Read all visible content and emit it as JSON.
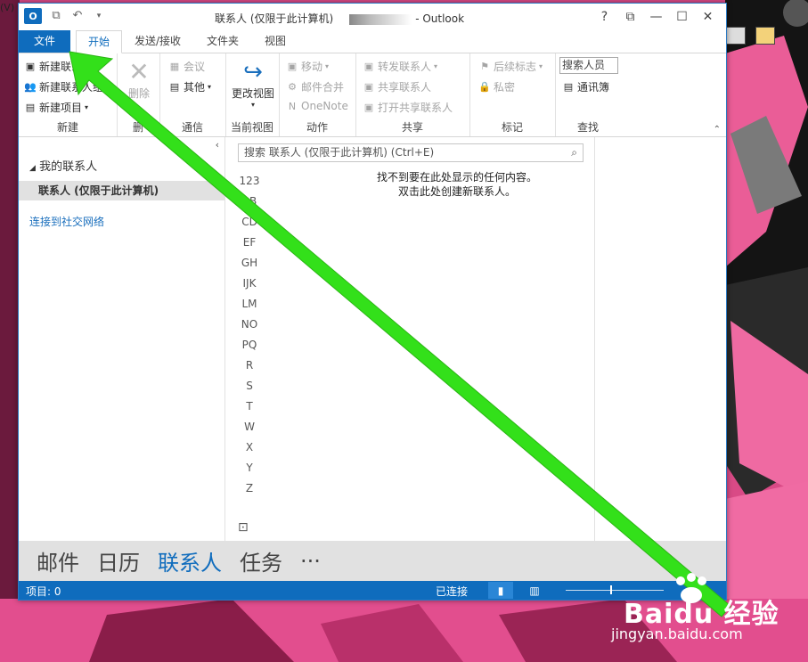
{
  "window": {
    "title": "联系人 (仅限于此计算机)",
    "app": "- Outlook",
    "logo": "O"
  },
  "bg": {
    "menu_fragment": "(V)"
  },
  "winbtns": {
    "help": "?",
    "ribbon_opts": "⧉",
    "min": "—",
    "max": "☐",
    "close": "✕"
  },
  "tabs": [
    "文件",
    "开始",
    "发送/接收",
    "文件夹",
    "视图"
  ],
  "ribbon": {
    "new": {
      "label": "新建",
      "items": [
        "新建联系人",
        "新建联系人组",
        "新建项目"
      ]
    },
    "delete": {
      "label": "删",
      "btn": "删除"
    },
    "comm": {
      "label": "通信",
      "items": [
        "会议",
        "其他"
      ]
    },
    "view": {
      "label": "当前视图",
      "btn": "更改视图"
    },
    "actions": {
      "label": "动作",
      "items": [
        "移动",
        "邮件合并",
        "OneNote"
      ]
    },
    "share": {
      "label": "共享",
      "items": [
        "转发联系人",
        "共享联系人",
        "打开共享联系人"
      ]
    },
    "tags": {
      "label": "标记",
      "items": [
        "后续标志",
        "私密"
      ]
    },
    "find": {
      "label": "查找",
      "search_people": "搜索人员",
      "address_book": "通讯簿"
    }
  },
  "nav": {
    "header": "我的联系人",
    "selected": "联系人 (仅限于此计算机)",
    "link": "连接到社交网络"
  },
  "list": {
    "search_placeholder": "搜索 联系人 (仅限于此计算机) (Ctrl+E)",
    "alpha": [
      "123",
      "AB",
      "CD",
      "EF",
      "GH",
      "IJK",
      "LM",
      "NO",
      "PQ",
      "R",
      "S",
      "T",
      "W",
      "X",
      "Y",
      "Z"
    ],
    "empty_line1": "找不到要在此处显示的任何内容。",
    "empty_line2": "双击此处创建新联系人。"
  },
  "peek": [
    "邮件",
    "日历",
    "联系人",
    "任务",
    "···"
  ],
  "status": {
    "items": "项目: 0",
    "connected": "已连接"
  },
  "watermark": {
    "logo": "Baidu 经验",
    "url": "jingyan.baidu.com"
  },
  "colors": {
    "accent": "#0f6cbd",
    "arrow": "#33e01a",
    "desktop": "#d94a86"
  }
}
